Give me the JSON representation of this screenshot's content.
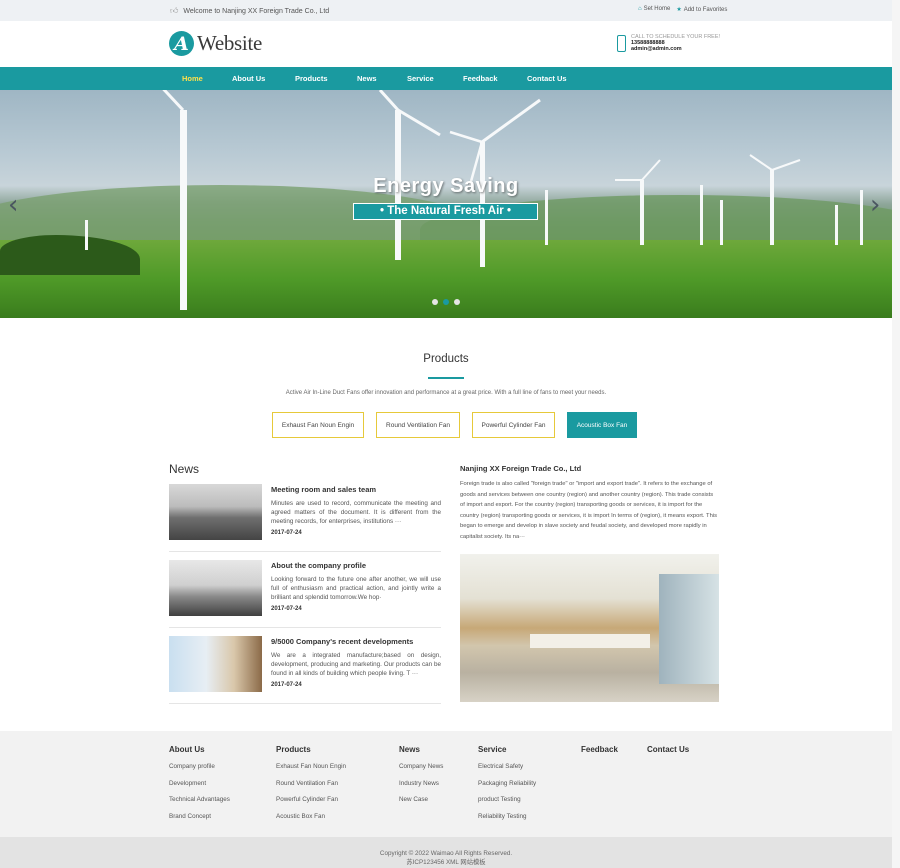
{
  "topbar": {
    "welcome": "Welcome to Nanjing XX Foreign Trade Co., Ltd",
    "set_home": "Set Home",
    "add_favorites": "Add to Favorites"
  },
  "header": {
    "logo_letter": "A",
    "logo_text": "Website",
    "contact_line1": "CALL TO SCHEDULE YOUR FREE!",
    "contact_phone": "13588888888",
    "contact_email": "admin@admin.com"
  },
  "nav": {
    "items": [
      "Home",
      "About Us",
      "Products",
      "News",
      "Service",
      "Feedback",
      "Contact Us"
    ],
    "active": "Home"
  },
  "banner": {
    "title": "Energy Saving",
    "subtitle": "• The Natural Fresh Air •",
    "prev_arrow": "‹",
    "next_arrow": "›",
    "slide_count": 3,
    "active_slide": 2
  },
  "products": {
    "title": "Products",
    "description": "Active Air In-Line Duct Fans offer innovation and performance at a great price. With a full line of fans to meet your needs.",
    "tabs": [
      "Exhaust Fan Noun Engin",
      "Round Ventilation Fan",
      "Powerful Cylinder Fan",
      "Acoustic Box Fan"
    ],
    "active_tab": "Acoustic Box Fan"
  },
  "news": {
    "title": "News",
    "items": [
      {
        "title": "Meeting room and sales team",
        "body": "Minutes are used to record, communicate the meeting and agreed matters of the document. It is different from the meeting records, for enterprises, institutions ···",
        "date": "2017-07-24"
      },
      {
        "title": "About the company profile",
        "body": "Looking forward to the future one after another, we will use full of enthusiasm and practical action, and jointly write a brilliant and splendid tomorrow.We hop·",
        "date": "2017-07-24"
      },
      {
        "title": "9/5000 Company's recent developments",
        "body": "We are a integrated manufacture;based on design, development, producing and marketing. Our products can be found in all kinds of building which people living. T ···",
        "date": "2017-07-24"
      }
    ]
  },
  "company": {
    "title": "Nanjing XX Foreign Trade Co., Ltd",
    "body": "Foreign trade is also called \"foreign trade\" or \"import and export trade\". It refers to the exchange of goods and services between one country (region) and another country (region). This trade consists of import and export. For the country (region) transporting goods or services, it is import for the country (region) transporting goods or services, it is import In terms of (region), it means export. This began to emerge and develop in slave society and feudal society, and developed more rapidly in capitalist society. Its na···"
  },
  "footer": {
    "columns": [
      {
        "heading": "About Us",
        "links": [
          "Company profile",
          "Development",
          "Technical Advantages",
          "Brand Concept"
        ]
      },
      {
        "heading": "Products",
        "links": [
          "Exhaust Fan Noun Engin",
          "Round Ventilation Fan",
          "Powerful Cylinder Fan",
          "Acoustic Box Fan"
        ]
      },
      {
        "heading": "News",
        "links": [
          "Company News",
          "Industry News",
          "New Case"
        ]
      },
      {
        "heading": "Service",
        "links": [
          "Electrical Safety",
          "Packaging Reliability",
          "product Testing",
          "Reliability Testing"
        ]
      },
      {
        "heading": "Feedback",
        "links": []
      },
      {
        "heading": "Contact Us",
        "links": []
      }
    ],
    "copyright": "Copyright © 2022 Waimao All Rights Reserved.",
    "icp": "苏ICP123456 XML 网站模板"
  },
  "colors": {
    "accent": "#1a9aa0",
    "nav_active": "#ffe24a",
    "tab_border": "#e6c93a"
  }
}
